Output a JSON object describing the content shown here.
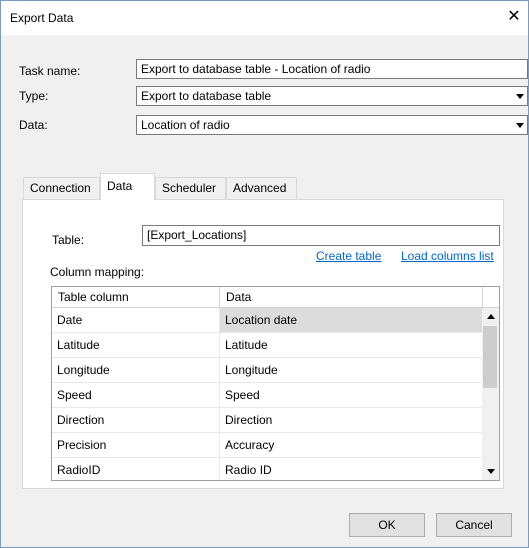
{
  "window": {
    "title": "Export Data"
  },
  "form": {
    "task_name_label": "Task name:",
    "task_name_value": "Export to database table - Location of radio",
    "type_label": "Type:",
    "type_value": "Export to database table",
    "data_label": "Data:",
    "data_value": "Location of radio"
  },
  "tabs": [
    {
      "label": "Connection",
      "active": false
    },
    {
      "label": "Data",
      "active": true
    },
    {
      "label": "Scheduler",
      "active": false
    },
    {
      "label": "Advanced",
      "active": false
    }
  ],
  "data_tab": {
    "table_label": "Table:",
    "table_value": "[Export_Locations]",
    "create_table_link": "Create table",
    "load_columns_link": "Load columns list",
    "mapping_label": "Column mapping:",
    "grid": {
      "headers": [
        "Table column",
        "Data"
      ],
      "rows": [
        [
          "Date",
          "Location date"
        ],
        [
          "Latitude",
          "Latitude"
        ],
        [
          "Longitude",
          "Longitude"
        ],
        [
          "Speed",
          "Speed"
        ],
        [
          "Direction",
          "Direction"
        ],
        [
          "Precision",
          "Accuracy"
        ],
        [
          "RadioID",
          "Radio ID"
        ]
      ]
    }
  },
  "buttons": {
    "ok": "OK",
    "cancel": "Cancel"
  }
}
